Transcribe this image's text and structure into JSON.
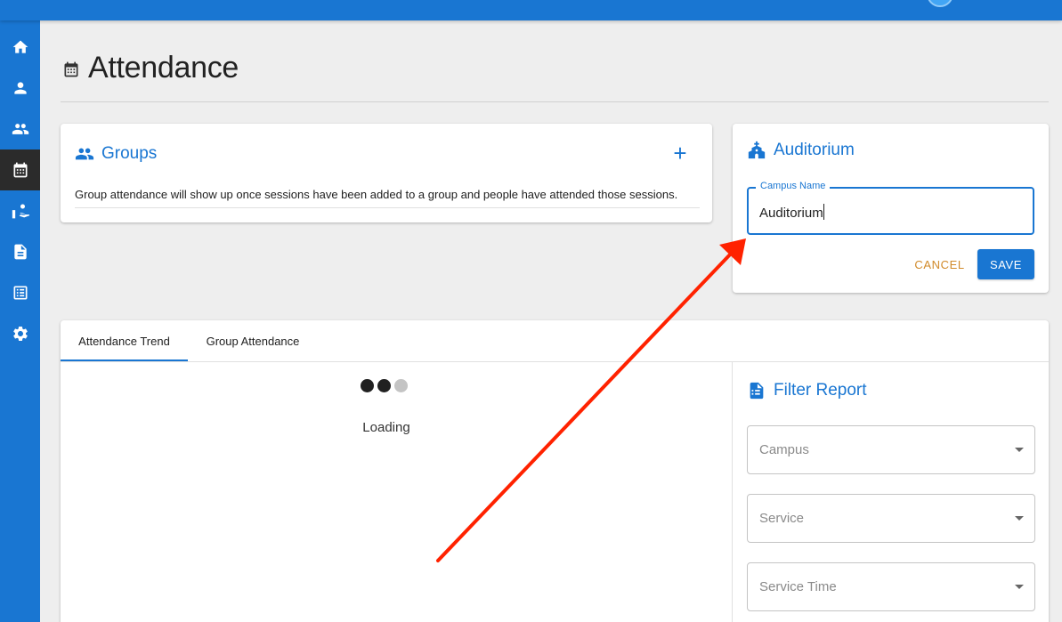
{
  "app": {
    "nav": [
      {
        "icon": "home-icon",
        "label": "Home"
      },
      {
        "icon": "person-icon",
        "label": "People"
      },
      {
        "icon": "groups-icon",
        "label": "Groups"
      },
      {
        "icon": "calendar-icon",
        "label": "Attendance",
        "active": true
      },
      {
        "icon": "donations-icon",
        "label": "Donations"
      },
      {
        "icon": "document-icon",
        "label": "Forms"
      },
      {
        "icon": "list-icon",
        "label": "Reports"
      },
      {
        "icon": "gear-icon",
        "label": "Settings"
      }
    ],
    "accent_color": "#1976d2",
    "active_nav_color": "#2b2b2b"
  },
  "page": {
    "title": "Attendance",
    "title_icon": "calendar-icon"
  },
  "groups_card": {
    "title": "Groups",
    "icon": "groups-icon",
    "add_label": "+",
    "message": "Group attendance will show up once sessions have been added to a group and people have attended those sessions."
  },
  "campus_card": {
    "title": "Auditorium",
    "icon": "church-icon",
    "field_label": "Campus Name",
    "field_value": "Auditorium",
    "cancel_label": "CANCEL",
    "save_label": "SAVE",
    "cancel_color": "#d18a2a"
  },
  "report": {
    "tabs": [
      {
        "label": "Attendance Trend",
        "selected": true
      },
      {
        "label": "Group Attendance",
        "selected": false
      }
    ],
    "loading_text": "Loading",
    "filter": {
      "title": "Filter Report",
      "icon": "report-icon",
      "selects": [
        {
          "placeholder": "Campus"
        },
        {
          "placeholder": "Service"
        },
        {
          "placeholder": "Service Time"
        }
      ]
    }
  },
  "annotation": {
    "type": "arrow",
    "color": "#ff2200"
  }
}
